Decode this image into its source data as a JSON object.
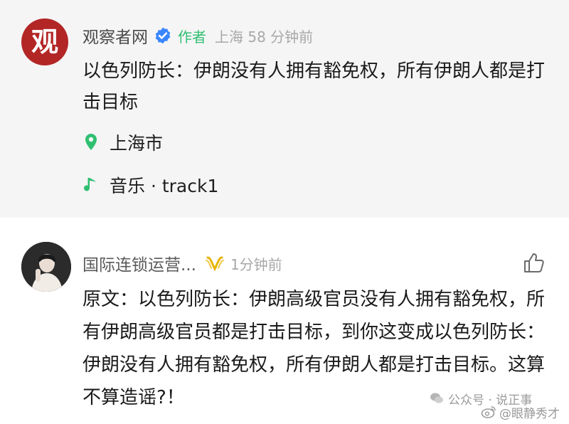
{
  "post": {
    "avatar_text": "观",
    "author_name": "观察者网",
    "author_tag": "作者",
    "meta": "上海 58 分钟前",
    "body": "以色列防长：伊朗没有人拥有豁免权，所有伊朗人都是打击目标",
    "location": "上海市",
    "music": "音乐 · track1",
    "colors": {
      "accent": "#2fbf71",
      "logo": "#b32626",
      "verified": "#3a86ff"
    },
    "icons": {
      "verified": "verified-badge-icon",
      "location": "location-pin-icon",
      "music": "music-note-icon"
    }
  },
  "comment": {
    "commenter_name": "国际连锁运营...",
    "time": "1分钟前",
    "body": "原文：以色列防长：伊朗高级官员没有人拥有豁免权，所有伊朗高级官员都是打击目标，到你这变成以色列防长：伊朗没有人拥有豁免权，所有伊朗人都是打击目标。这算不算造谣?！",
    "icons": {
      "badge": "vip-badge-icon",
      "like": "thumbs-up-icon"
    }
  },
  "watermarks": {
    "wechat": "公众号 · 说正事",
    "weibo": "@眼静秀才"
  }
}
